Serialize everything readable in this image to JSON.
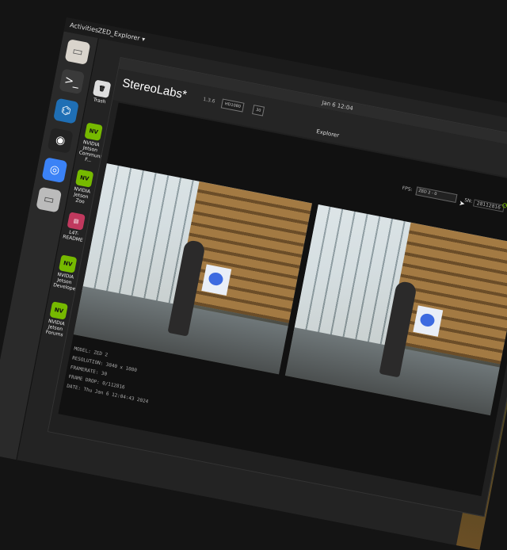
{
  "top_bar": {
    "activities": "Activities",
    "app_menu": "ZED_Explorer ▾",
    "clock": "Jan 6  12:04"
  },
  "dock": [
    {
      "name": "files",
      "glyph": "▭",
      "color": "#d9d4cc"
    },
    {
      "name": "terminal",
      "glyph": ">_",
      "color": "#3a3a3a"
    },
    {
      "name": "vscode",
      "glyph": "⌬",
      "color": "#1f6fb5"
    },
    {
      "name": "obs",
      "glyph": "◉",
      "color": "#222222"
    },
    {
      "name": "chromium",
      "glyph": "◎",
      "color": "#3b82f6"
    },
    {
      "name": "app",
      "glyph": "▭",
      "color": "#bbbbbb"
    }
  ],
  "desktop_icons": [
    {
      "label": "Trash",
      "glyph": "🗑"
    },
    {
      "label": "NVIDIA Jetson Community F...",
      "glyph": "NV"
    },
    {
      "label": "NVIDIA Jetson Zoo",
      "glyph": "NV"
    },
    {
      "label": "L4T-README",
      "glyph": "▤"
    },
    {
      "label": "NVIDIA Jetson Develope...",
      "glyph": "NV"
    },
    {
      "label": "NVIDIA Jetson Forums",
      "glyph": "NV"
    }
  ],
  "window": {
    "title": "Jan 6  12:04",
    "explorer_title": "Explorer"
  },
  "app": {
    "brand": "StereoLabs*",
    "version": "1.3.6",
    "resolution_select": "HD1080",
    "fps_select": "30",
    "fps_label": "FPS:",
    "camera_select": "ZED 2 - 0",
    "sn_label": "SN:",
    "sn_value": "28112816"
  },
  "info": {
    "model": "MODEL: ZED 2",
    "resolution": "RESOLUTION: 3840 x 1080",
    "framerate": "FRAMERATE: 30",
    "frame_drop": "FRAME DROP: 0/112816",
    "date": "DATE: Thu Jan 6 12:04:43 2024"
  },
  "colors": {
    "accent": "#76b900",
    "close": "#e95420"
  }
}
